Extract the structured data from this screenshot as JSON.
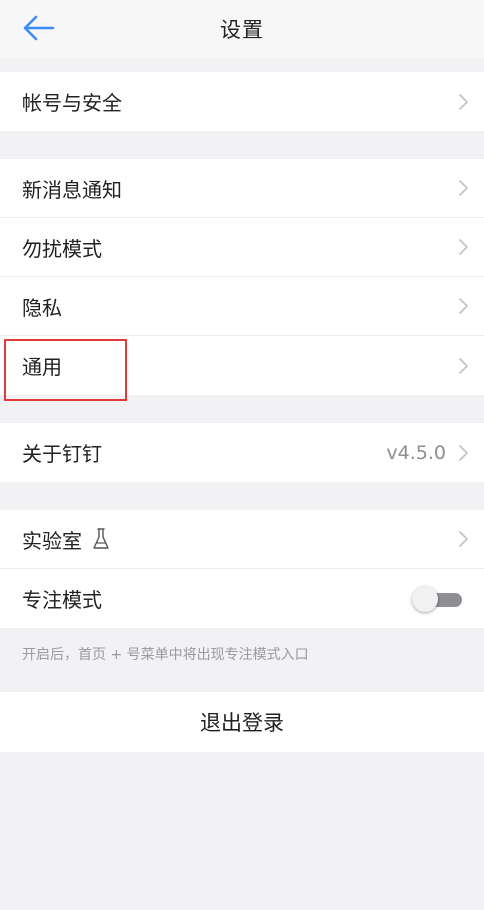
{
  "header": {
    "title": "设置",
    "back_icon": "arrow-left-icon",
    "accent_color": "#3b8cf5"
  },
  "groups": [
    {
      "items": [
        {
          "label": "帐号与安全"
        }
      ]
    },
    {
      "items": [
        {
          "label": "新消息通知"
        },
        {
          "label": "勿扰模式"
        },
        {
          "label": "隐私"
        },
        {
          "label": "通用"
        }
      ]
    },
    {
      "items": [
        {
          "label": "关于钉钉",
          "value": "v4.5.0"
        }
      ]
    },
    {
      "items": [
        {
          "label": "实验室",
          "icon": "flask-icon"
        },
        {
          "label": "专注模式",
          "toggle": false
        }
      ]
    }
  ],
  "hint": "开启后，首页 + 号菜单中将出现专注模式入口",
  "logout_label": "退出登录",
  "highlight_color": "#e03a3a"
}
